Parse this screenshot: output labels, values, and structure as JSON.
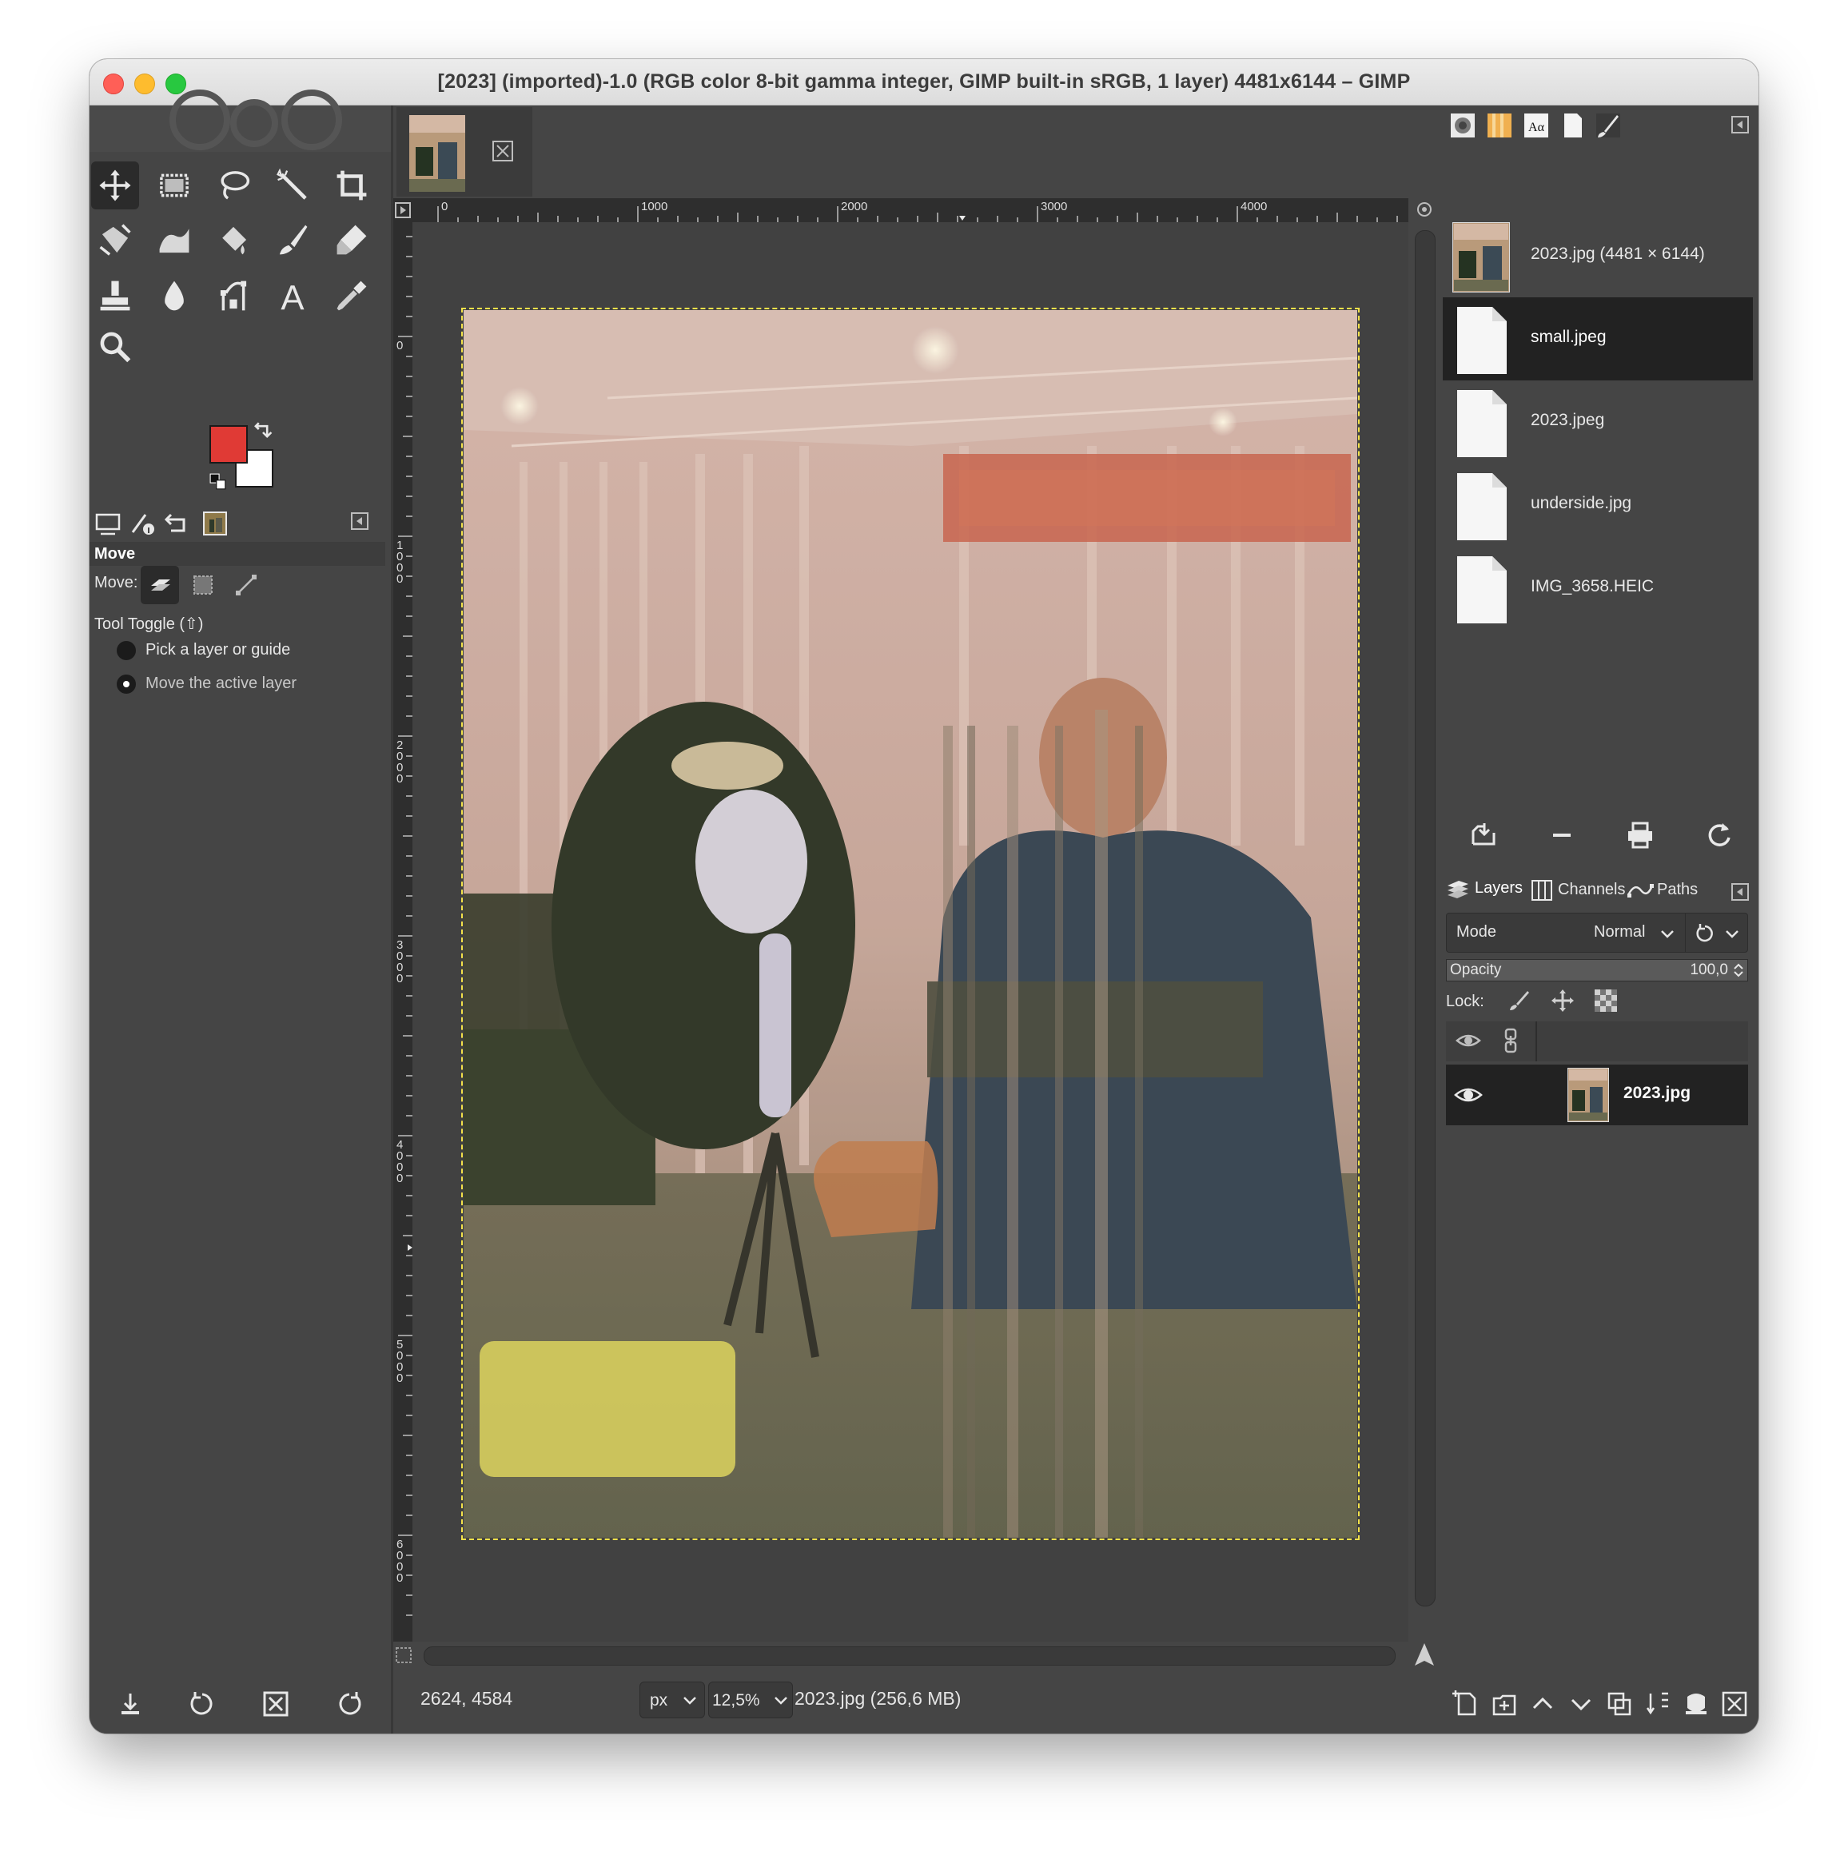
{
  "window": {
    "title": "[2023] (imported)-1.0 (RGB color 8-bit gamma integer, GIMP built-in sRGB, 1 layer) 4481x6144 – GIMP"
  },
  "toolbox": {
    "tools": [
      {
        "name": "move-tool-icon",
        "active": true
      },
      {
        "name": "rect-select-tool-icon"
      },
      {
        "name": "free-select-tool-icon"
      },
      {
        "name": "fuzzy-select-tool-icon"
      },
      {
        "name": "crop-tool-icon"
      },
      {
        "name": "unified-transform-tool-icon"
      },
      {
        "name": "warp-transform-tool-icon"
      },
      {
        "name": "bucket-fill-tool-icon"
      },
      {
        "name": "paintbrush-tool-icon"
      },
      {
        "name": "eraser-tool-icon"
      },
      {
        "name": "clone-tool-icon"
      },
      {
        "name": "blur-tool-icon"
      },
      {
        "name": "paths-tool-icon"
      },
      {
        "name": "text-tool-icon"
      },
      {
        "name": "color-picker-tool-icon"
      },
      {
        "name": "zoom-tool-icon"
      }
    ],
    "foreground_color": "#e03a35",
    "background_color": "#ffffff"
  },
  "tool_options": {
    "header": "Move",
    "move_label": "Move:",
    "tool_toggle_label": "Tool Toggle  (⇧)",
    "radio_options": [
      {
        "label": "Pick a layer or guide",
        "selected": false
      },
      {
        "label": "Move the active layer",
        "selected": true
      }
    ]
  },
  "canvas": {
    "ruler_h_labels": [
      "0",
      "1000",
      "2000",
      "3000",
      "4000"
    ],
    "ruler_v_labels": [
      "0",
      "1000",
      "2000",
      "3000",
      "4000",
      "5000",
      "6000"
    ]
  },
  "statusbar": {
    "coordinates": "2624, 4584",
    "unit": "px",
    "zoom": "12,5%",
    "file_info": "2023.jpg (256,6 MB)"
  },
  "images_panel": {
    "items": [
      {
        "name": "2023.jpg (4481 × 6144)",
        "has_thumb": true,
        "selected": false
      },
      {
        "name": "small.jpeg",
        "selected": true
      },
      {
        "name": "2023.jpeg",
        "selected": false
      },
      {
        "name": "underside.jpg",
        "selected": false
      },
      {
        "name": "IMG_3658.HEIC",
        "selected": false
      }
    ]
  },
  "layers_panel": {
    "tabs": [
      "Layers",
      "Channels",
      "Paths"
    ],
    "mode_label": "Mode",
    "mode_value": "Normal",
    "opacity_label": "Opacity",
    "opacity_value": "100,0",
    "opacity_fraction": 1.0,
    "lock_label": "Lock:",
    "layers": [
      {
        "name": "2023.jpg",
        "visible": true
      }
    ]
  }
}
